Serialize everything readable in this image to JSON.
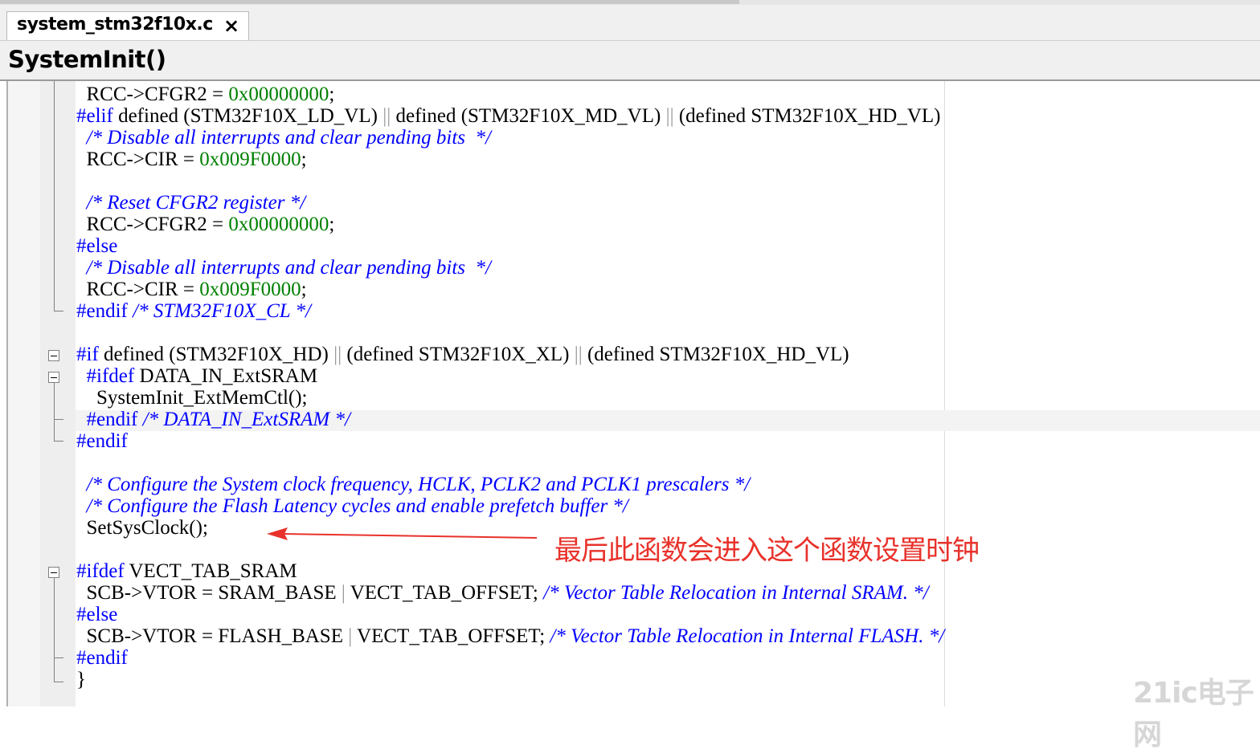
{
  "tab": {
    "filename": "system_stm32f10x.c",
    "close_symbol": "×"
  },
  "function_bar": {
    "name": "SystemInit()"
  },
  "code_lines": [
    {
      "indent": "  ",
      "parts": [
        {
          "t": "RCC->CFGR2 = ",
          "c": "p"
        },
        {
          "t": "0x00000000",
          "c": "num"
        },
        {
          "t": ";",
          "c": "p"
        }
      ]
    },
    {
      "indent": "",
      "parts": [
        {
          "t": "#elif",
          "c": "kw"
        },
        {
          "t": " defined (STM32F10X_LD_VL) ",
          "c": "p"
        },
        {
          "t": "||",
          "c": "sep"
        },
        {
          "t": " defined (STM32F10X_MD_VL) ",
          "c": "p"
        },
        {
          "t": "||",
          "c": "sep"
        },
        {
          "t": " (defined STM32F10X_HD_VL)",
          "c": "p"
        }
      ]
    },
    {
      "indent": "  ",
      "parts": [
        {
          "t": "/* Disable all interrupts and clear pending bits  */",
          "c": "cm"
        }
      ]
    },
    {
      "indent": "  ",
      "parts": [
        {
          "t": "RCC->CIR = ",
          "c": "p"
        },
        {
          "t": "0x009F0000",
          "c": "num"
        },
        {
          "t": ";",
          "c": "p"
        }
      ]
    },
    {
      "indent": "",
      "parts": []
    },
    {
      "indent": "  ",
      "parts": [
        {
          "t": "/* Reset CFGR2 register */",
          "c": "cm"
        }
      ]
    },
    {
      "indent": "  ",
      "parts": [
        {
          "t": "RCC->CFGR2 = ",
          "c": "p"
        },
        {
          "t": "0x00000000",
          "c": "num"
        },
        {
          "t": ";",
          "c": "p"
        }
      ]
    },
    {
      "indent": "",
      "parts": [
        {
          "t": "#else",
          "c": "kw"
        }
      ]
    },
    {
      "indent": "  ",
      "parts": [
        {
          "t": "/* Disable all interrupts and clear pending bits  */",
          "c": "cm"
        }
      ]
    },
    {
      "indent": "  ",
      "parts": [
        {
          "t": "RCC->CIR = ",
          "c": "p"
        },
        {
          "t": "0x009F0000",
          "c": "num"
        },
        {
          "t": ";",
          "c": "p"
        }
      ]
    },
    {
      "indent": "",
      "parts": [
        {
          "t": "#endif",
          "c": "kw"
        },
        {
          "t": " ",
          "c": "p"
        },
        {
          "t": "/* STM32F10X_CL */",
          "c": "cm"
        }
      ]
    },
    {
      "indent": "",
      "parts": []
    },
    {
      "indent": "",
      "parts": [
        {
          "t": "#if",
          "c": "kw"
        },
        {
          "t": " defined (STM32F10X_HD) ",
          "c": "p"
        },
        {
          "t": "||",
          "c": "sep"
        },
        {
          "t": " (defined STM32F10X_XL) ",
          "c": "p"
        },
        {
          "t": "||",
          "c": "sep"
        },
        {
          "t": " (defined STM32F10X_HD_VL)",
          "c": "p"
        }
      ]
    },
    {
      "indent": "  ",
      "parts": [
        {
          "t": "#ifdef",
          "c": "kw"
        },
        {
          "t": " DATA_IN_ExtSRAM",
          "c": "p"
        }
      ]
    },
    {
      "indent": "    ",
      "parts": [
        {
          "t": "SystemInit_ExtMemCtl();",
          "c": "p"
        }
      ]
    },
    {
      "indent": "  ",
      "parts": [
        {
          "t": "#endif",
          "c": "kw"
        },
        {
          "t": " ",
          "c": "p"
        },
        {
          "t": "/* DATA_IN_ExtSRAM */",
          "c": "cm"
        }
      ]
    },
    {
      "indent": "",
      "parts": [
        {
          "t": "#endif",
          "c": "kw"
        }
      ]
    },
    {
      "indent": "",
      "parts": []
    },
    {
      "indent": "  ",
      "parts": [
        {
          "t": "/* Configure the System clock frequency, HCLK, PCLK2 and PCLK1 prescalers */",
          "c": "cm"
        }
      ]
    },
    {
      "indent": "  ",
      "parts": [
        {
          "t": "/* Configure the Flash Latency cycles and enable prefetch buffer */",
          "c": "cm"
        }
      ]
    },
    {
      "indent": "  ",
      "parts": [
        {
          "t": "SetSysClock();",
          "c": "p"
        }
      ]
    },
    {
      "indent": "",
      "parts": []
    },
    {
      "indent": "",
      "parts": [
        {
          "t": "#ifdef",
          "c": "kw"
        },
        {
          "t": " VECT_TAB_SRAM",
          "c": "p"
        }
      ]
    },
    {
      "indent": "  ",
      "parts": [
        {
          "t": "SCB->VTOR = SRAM_BASE ",
          "c": "p"
        },
        {
          "t": "|",
          "c": "sep"
        },
        {
          "t": " VECT_TAB_OFFSET; ",
          "c": "p"
        },
        {
          "t": "/* Vector Table Relocation in Internal SRAM. */",
          "c": "cm"
        }
      ]
    },
    {
      "indent": "",
      "parts": [
        {
          "t": "#else",
          "c": "kw"
        }
      ]
    },
    {
      "indent": "  ",
      "parts": [
        {
          "t": "SCB->VTOR = FLASH_BASE ",
          "c": "p"
        },
        {
          "t": "|",
          "c": "sep"
        },
        {
          "t": " VECT_TAB_OFFSET; ",
          "c": "p"
        },
        {
          "t": "/* Vector Table Relocation in Internal FLASH. */",
          "c": "cm"
        }
      ]
    },
    {
      "indent": "",
      "parts": [
        {
          "t": "#endif",
          "c": "kw"
        }
      ]
    },
    {
      "indent": "",
      "parts": [
        {
          "t": "}",
          "c": "p"
        }
      ]
    }
  ],
  "annotation": {
    "text": "最后此函数会进入这个函数设置时钟",
    "color": "#e8322b"
  },
  "watermark": {
    "text": "21ic电子网"
  },
  "colors": {
    "keyword": "#0000ff",
    "number": "#008000",
    "comment": "#0000ff",
    "annotation": "#e8322b"
  }
}
